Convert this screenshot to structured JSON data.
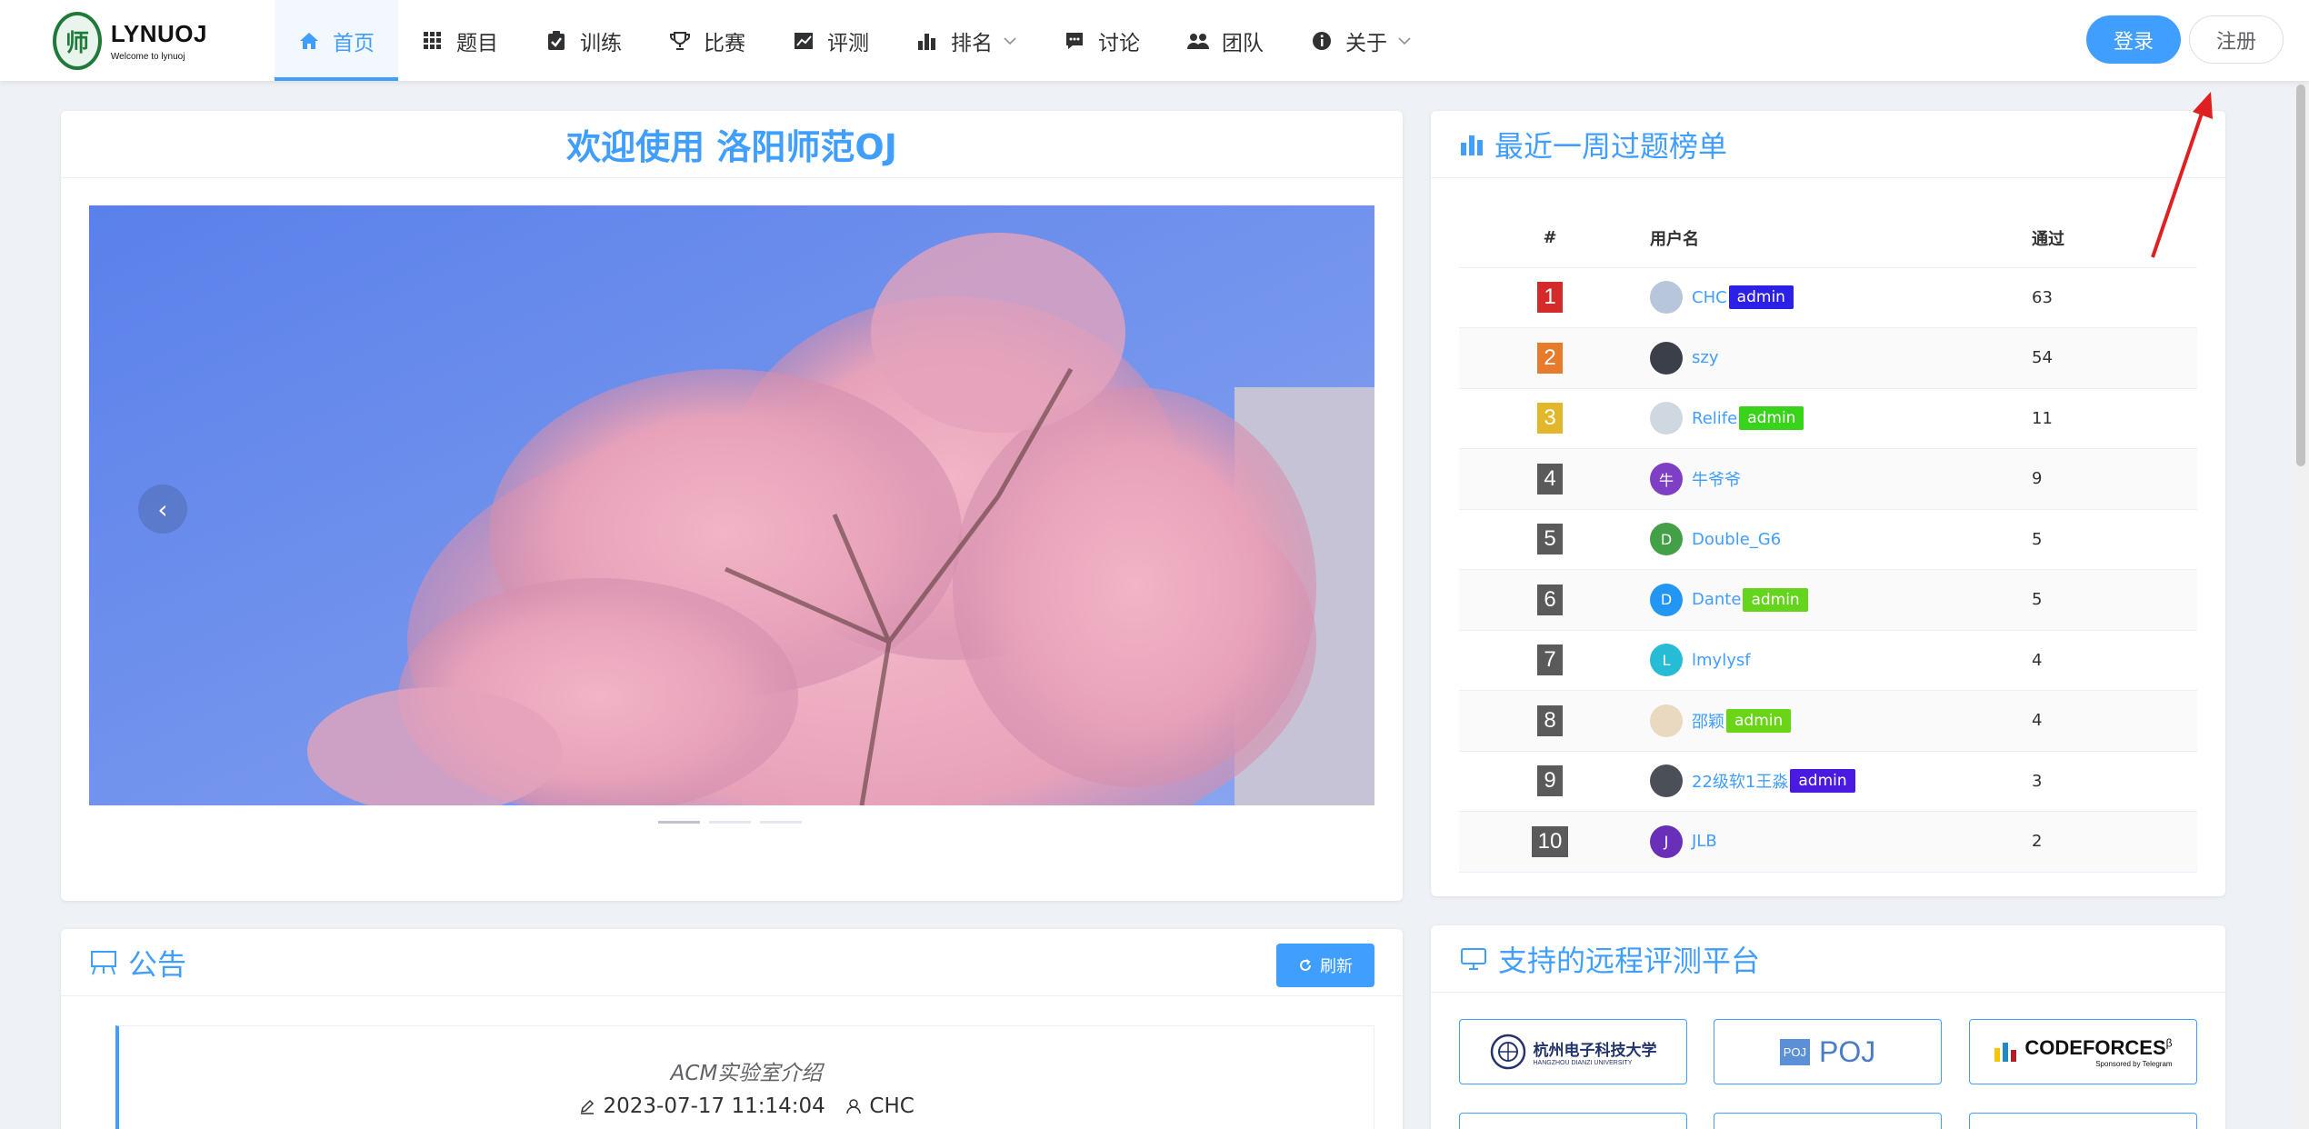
{
  "header": {
    "logo_title": "LYNUOJ",
    "logo_subtitle": "Welcome to lynuoj",
    "nav": [
      {
        "label": "首页",
        "icon": "home-icon",
        "active": true
      },
      {
        "label": "题目",
        "icon": "grid-icon"
      },
      {
        "label": "训练",
        "icon": "clipboard-check-icon"
      },
      {
        "label": "比赛",
        "icon": "trophy-icon"
      },
      {
        "label": "评测",
        "icon": "chart-line-icon"
      },
      {
        "label": "排名",
        "icon": "bar-chart-icon",
        "dropdown": true
      },
      {
        "label": "讨论",
        "icon": "comment-icon"
      },
      {
        "label": "团队",
        "icon": "users-icon"
      },
      {
        "label": "关于",
        "icon": "info-icon",
        "dropdown": true
      }
    ],
    "login_label": "登录",
    "register_label": "注册"
  },
  "welcome": {
    "title": "欢迎使用 洛阳师范OJ",
    "carousel_prev": "‹",
    "indicator_count": 3
  },
  "rank": {
    "title": "最近一周过题榜单",
    "columns": [
      "#",
      "用户名",
      "通过"
    ],
    "rows": [
      {
        "rank": "1",
        "user": "CHC",
        "tag": "admin",
        "tag_color": "#2c1fe6",
        "ac": "63",
        "avatar_color": "#b8c6dc",
        "avatar_text": ""
      },
      {
        "rank": "2",
        "user": "szy",
        "tag": "",
        "ac": "54",
        "avatar_color": "#3b3f4a",
        "avatar_text": ""
      },
      {
        "rank": "3",
        "user": "Relife",
        "tag": "admin",
        "tag_color": "#39d31c",
        "ac": "11",
        "avatar_color": "#cfd8e0",
        "avatar_text": ""
      },
      {
        "rank": "4",
        "user": "牛爷爷",
        "tag": "",
        "ac": "9",
        "avatar_color": "#7e3fc4",
        "avatar_text": "牛"
      },
      {
        "rank": "5",
        "user": "Double_G6",
        "tag": "",
        "ac": "5",
        "avatar_color": "#43a047",
        "avatar_text": "D"
      },
      {
        "rank": "6",
        "user": "Dante",
        "tag": "admin",
        "tag_color": "#64d41d",
        "ac": "5",
        "avatar_color": "#2196f3",
        "avatar_text": "D"
      },
      {
        "rank": "7",
        "user": "lmylysf",
        "tag": "",
        "ac": "4",
        "avatar_color": "#26bcd6",
        "avatar_text": "L"
      },
      {
        "rank": "8",
        "user": "邵颖",
        "tag": "admin",
        "tag_color": "#6ad417",
        "ac": "4",
        "avatar_color": "#e8d9c0",
        "avatar_text": ""
      },
      {
        "rank": "9",
        "user": "22级软1王淼",
        "tag": "admin",
        "tag_color": "#4a1ae0",
        "ac": "3",
        "avatar_color": "#4b4f57",
        "avatar_text": ""
      },
      {
        "rank": "10",
        "user": "JLB",
        "tag": "",
        "ac": "2",
        "avatar_color": "#6a2fb8",
        "avatar_text": "J"
      }
    ]
  },
  "notice": {
    "title": "公告",
    "refresh_label": "刷新",
    "item_title": "ACM实验室介绍",
    "item_date": "2023-07-17 11:14:04",
    "item_author": "CHC"
  },
  "remote": {
    "title": "支持的远程评测平台",
    "platforms": [
      {
        "name": "杭州电子科技大学",
        "subname": "HANGZHOU DIANZI UNIVERSITY"
      },
      {
        "name": "POJ",
        "badge": "POJ"
      },
      {
        "name": "CODEFORCES",
        "sup": "β",
        "subname": "Sponsored by Telegram"
      }
    ]
  },
  "colors": {
    "primary": "#409eff",
    "medal_1": "#d52a2a",
    "medal_2": "#e87a2c",
    "medal_3": "#e3b72b",
    "annotation_arrow": "#e02020"
  }
}
